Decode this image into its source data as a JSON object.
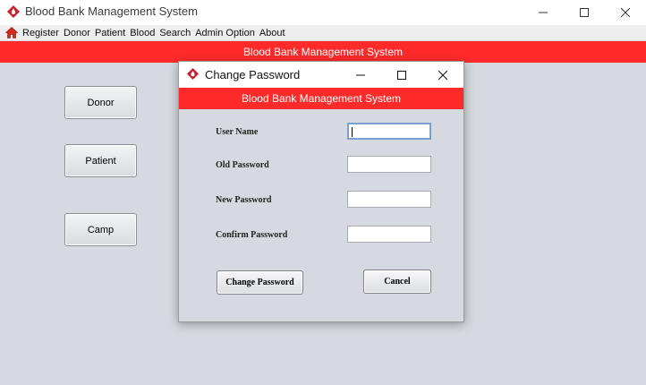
{
  "window": {
    "title": "Blood Bank Management System",
    "icon": "blood-drop-icon",
    "controls": [
      "minimize",
      "maximize",
      "close"
    ]
  },
  "menubar": {
    "home_icon": "home-icon",
    "items": [
      "Register",
      "Donor",
      "Patient",
      "Blood",
      "Search",
      "Admin Option",
      "About"
    ]
  },
  "banner": {
    "text": "Blood Bank Management System",
    "color": "#ff2b2b"
  },
  "sidebar": {
    "buttons": [
      "Donor",
      "Patient",
      "Camp"
    ]
  },
  "dialog": {
    "title": "Change Password",
    "icon": "blood-drop-icon",
    "banner": "Blood Bank Management System",
    "fields": [
      {
        "label": "User Name",
        "value": ""
      },
      {
        "label": "Old Password",
        "value": ""
      },
      {
        "label": "New Password",
        "value": ""
      },
      {
        "label": "Confirm Password",
        "value": ""
      }
    ],
    "buttons": {
      "submit": "Change Password",
      "cancel": "Cancel"
    }
  },
  "colors": {
    "accent": "#ff2b2b",
    "background": "#d6d9df",
    "icon_red": "#c8202e"
  }
}
